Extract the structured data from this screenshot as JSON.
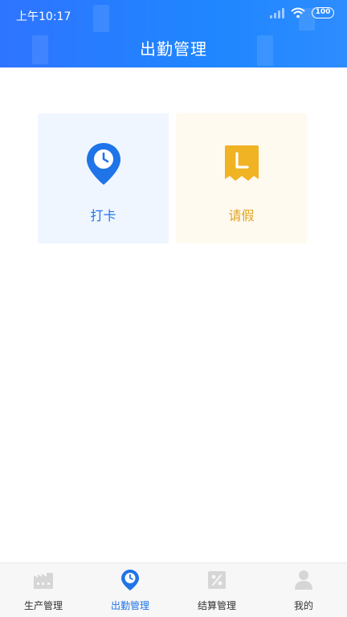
{
  "status": {
    "time": "上午10:17",
    "battery": "100"
  },
  "header": {
    "title": "出勤管理"
  },
  "cards": [
    {
      "label": "打卡",
      "icon": "clock-location-icon",
      "color": "#1f74e8"
    },
    {
      "label": "请假",
      "icon": "leave-request-icon",
      "color": "#f0b323"
    }
  ],
  "tabbar": {
    "active_index": 1,
    "items": [
      {
        "label": "生产管理",
        "icon": "factory-icon"
      },
      {
        "label": "出勤管理",
        "icon": "clock-location-icon"
      },
      {
        "label": "结算管理",
        "icon": "percent-icon"
      },
      {
        "label": "我的",
        "icon": "user-icon"
      }
    ]
  },
  "colors": {
    "primary": "#1f74e8",
    "accent": "#f0b323",
    "inactive_icon": "#d6d6d6"
  }
}
